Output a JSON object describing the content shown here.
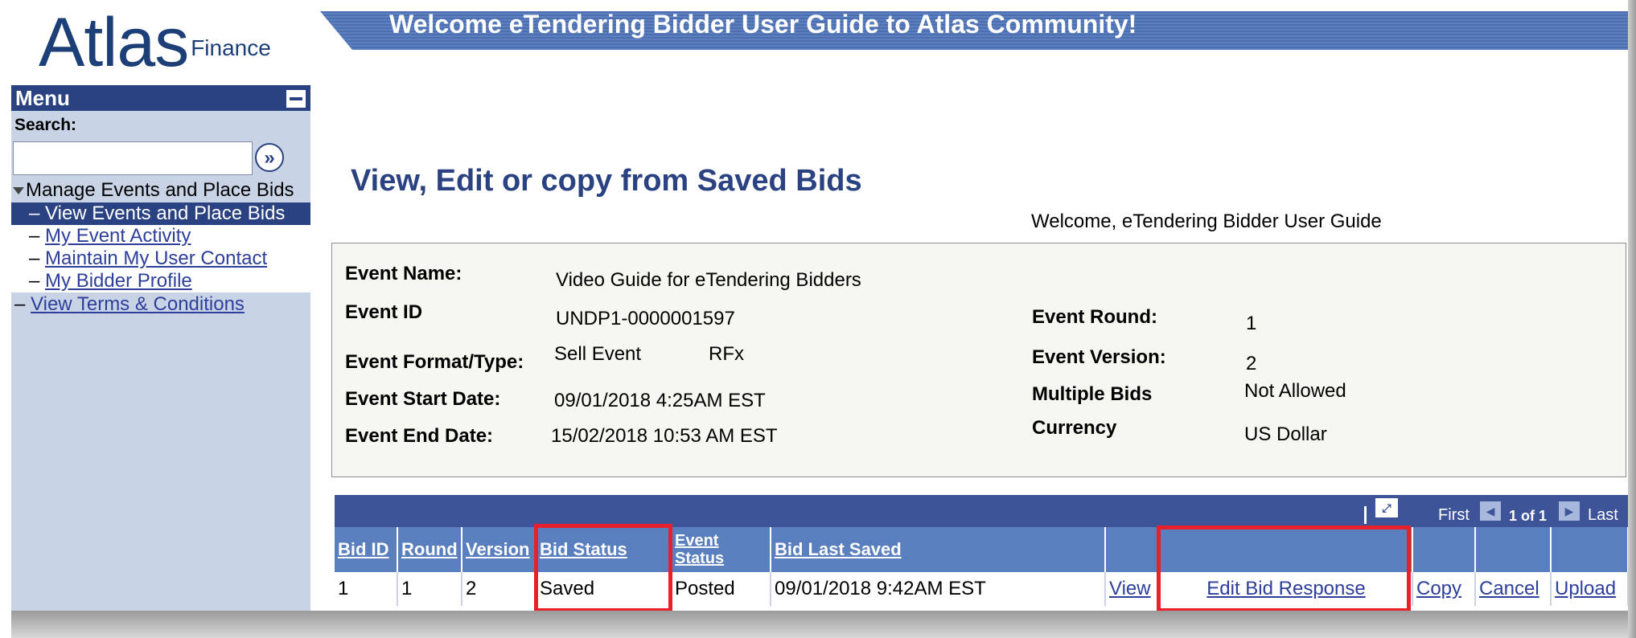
{
  "header": {
    "logo_main": "Atlas",
    "logo_sub": "Finance",
    "banner_title": "Welcome eTendering Bidder User Guide to Atlas Community!"
  },
  "sidebar": {
    "menu_title": "Menu",
    "search_label": "Search:",
    "search_value": "",
    "search_go": "»",
    "parent": "Manage Events and Place Bids",
    "items": [
      {
        "label": "View Events and Place Bids",
        "active": true
      },
      {
        "label": "My Event Activity",
        "active": false
      },
      {
        "label": "Maintain My User Contact",
        "active": false
      },
      {
        "label": "My Bidder Profile",
        "active": false
      }
    ],
    "terms": "View Terms & Conditions",
    "bullet": "–"
  },
  "main": {
    "title": "View, Edit or copy from Saved Bids",
    "welcome": "Welcome, eTendering Bidder User Guide"
  },
  "event": {
    "name_label": "Event Name:",
    "name_value": "Video Guide for eTendering Bidders",
    "id_label": "Event ID",
    "id_value": "UNDP1-0000001597",
    "format_label": "Event Format/Type:",
    "format_value": "Sell Event",
    "type_value": "RFx",
    "start_label": "Event Start Date:",
    "start_value": "09/01/2018  4:25AM EST",
    "end_label": "Event End Date:",
    "end_value": "15/02/2018 10:53 AM EST",
    "round_label": "Event Round:",
    "round_value": "1",
    "version_label": "Event Version:",
    "version_value": "2",
    "multiple_label": "Multiple Bids",
    "multiple_value": "Not Allowed",
    "currency_label": "Currency",
    "currency_value": "US Dollar"
  },
  "grid": {
    "nav_first": "First",
    "nav_range": "1 of 1",
    "nav_last": "Last",
    "columns": [
      "Bid ID",
      "Round",
      "Version",
      "Bid Status",
      "Event Status",
      "Bid Last Saved",
      "",
      "",
      "",
      "",
      ""
    ],
    "row": {
      "bid_id": "1",
      "round": "1",
      "version": "2",
      "bid_status": "Saved",
      "event_status": "Posted",
      "last_saved": "09/01/2018  9:42AM EST",
      "view": "View",
      "edit": "Edit Bid Response",
      "copy": "Copy",
      "cancel": "Cancel",
      "upload": "Upload"
    }
  },
  "colors": {
    "brand_navy": "#2a4281",
    "header_blue": "#5a7fbe",
    "highlight_red": "#e8202a"
  }
}
